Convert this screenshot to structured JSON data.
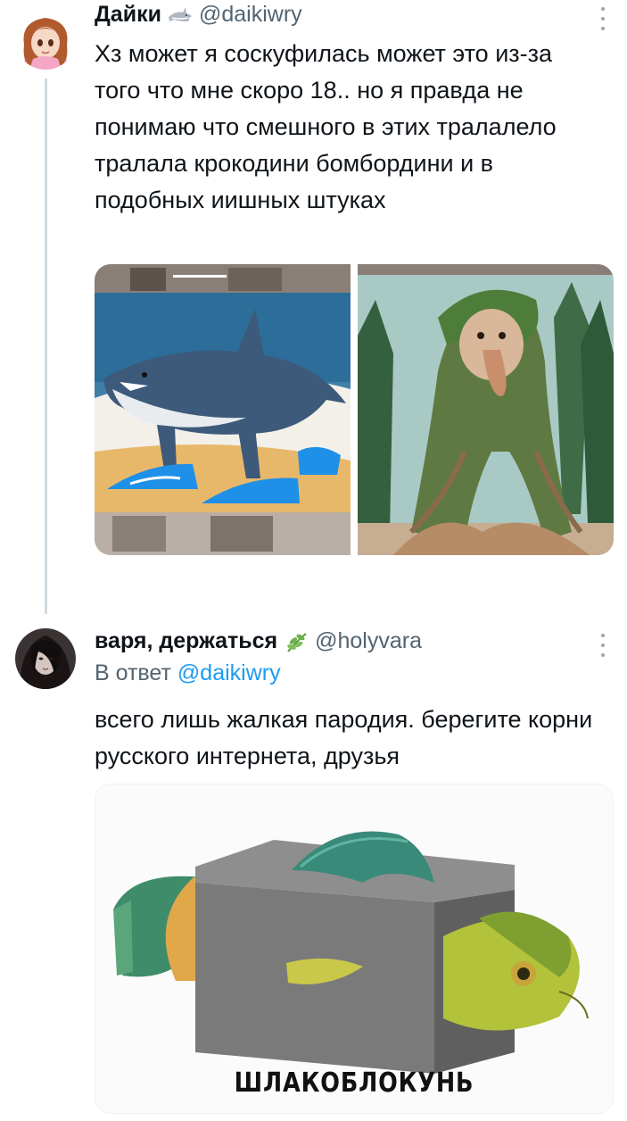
{
  "tweets": [
    {
      "author": {
        "display_name": "Дайки",
        "name_emoji": "shark-emoji",
        "handle": "@daikiwry",
        "avatar": "anime-girl-avatar"
      },
      "text": "Хз может я соскуфилась может это из-за того что мне скоро 18.. но я правда не понимаю что смешного в этих тралалело тралала крокодини бомбордини и в подобных иишных штуках",
      "media": [
        {
          "name": "shark-in-sneakers-image"
        },
        {
          "name": "tree-monkey-image"
        }
      ]
    },
    {
      "author": {
        "display_name": "варя, держаться",
        "name_emoji": "herb-emoji",
        "handle": "@holyvara",
        "avatar": "dark-hair-girl-avatar"
      },
      "reply_prefix": "В ответ",
      "reply_handle": "@daikiwry",
      "text": "всего лишь жалкая пародия. берегите корни русского интернета, друзья",
      "media": [
        {
          "name": "fish-cinder-block-image",
          "caption": "ШЛАКОБЛОКУНЬ"
        }
      ]
    }
  ],
  "colors": {
    "text": "#0f1419",
    "secondary": "#536471",
    "link": "#1d9bf0",
    "thread_line": "#cfd9de"
  }
}
